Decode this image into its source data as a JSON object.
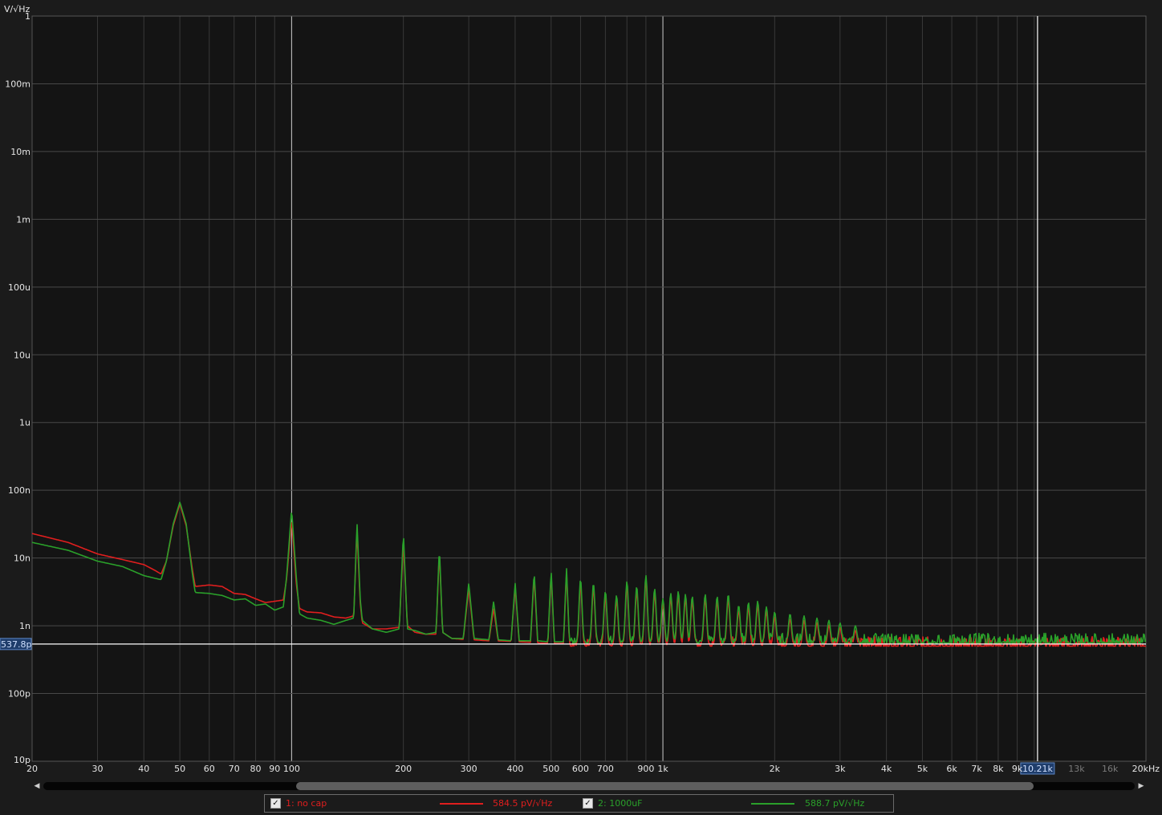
{
  "chart_data": {
    "type": "line",
    "ylabel": "V/√Hz",
    "xunit": "Hz",
    "xscale": "log",
    "yscale": "log",
    "xlim": [
      20,
      20000
    ],
    "ylim": [
      1e-11,
      1
    ],
    "grid": true,
    "y_ticks": [
      {
        "value": 1,
        "label": "1"
      },
      {
        "value": 0.1,
        "label": "100m"
      },
      {
        "value": 0.01,
        "label": "10m"
      },
      {
        "value": 0.001,
        "label": "1m"
      },
      {
        "value": 0.0001,
        "label": "100u"
      },
      {
        "value": 1e-05,
        "label": "10u"
      },
      {
        "value": 1e-06,
        "label": "1u"
      },
      {
        "value": 1e-07,
        "label": "100n"
      },
      {
        "value": 1e-08,
        "label": "10n"
      },
      {
        "value": 1e-09,
        "label": "1n"
      },
      {
        "value": 1e-10,
        "label": "100p"
      },
      {
        "value": 1e-11,
        "label": "10p"
      }
    ],
    "x_ticks": [
      {
        "value": 20,
        "label": "20"
      },
      {
        "value": 30,
        "label": "30"
      },
      {
        "value": 40,
        "label": "40"
      },
      {
        "value": 50,
        "label": "50"
      },
      {
        "value": 60,
        "label": "60"
      },
      {
        "value": 70,
        "label": "70"
      },
      {
        "value": 80,
        "label": "80"
      },
      {
        "value": 90,
        "label": "90"
      },
      {
        "value": 100,
        "label": "100"
      },
      {
        "value": 200,
        "label": "200"
      },
      {
        "value": 300,
        "label": "300"
      },
      {
        "value": 400,
        "label": "400"
      },
      {
        "value": 500,
        "label": "500"
      },
      {
        "value": 600,
        "label": "600"
      },
      {
        "value": 700,
        "label": "700"
      },
      {
        "value": 900,
        "label": "900"
      },
      {
        "value": 1000,
        "label": "1k"
      },
      {
        "value": 2000,
        "label": "2k"
      },
      {
        "value": 3000,
        "label": "3k"
      },
      {
        "value": 4000,
        "label": "4k"
      },
      {
        "value": 5000,
        "label": "5k"
      },
      {
        "value": 6000,
        "label": "6k"
      },
      {
        "value": 7000,
        "label": "7k"
      },
      {
        "value": 8000,
        "label": "8k"
      },
      {
        "value": 9000,
        "label": "9k"
      },
      {
        "value": 13000,
        "label": "13k",
        "dim": true
      },
      {
        "value": 16000,
        "label": "16k",
        "dim": true
      },
      {
        "value": 20000,
        "label": "20kHz"
      }
    ],
    "cursor_x": {
      "value": 10210,
      "label": "10.21k"
    },
    "cursor_y": {
      "value": 5.378e-10,
      "label": "537.8p"
    },
    "series": [
      {
        "name": "1: no cap",
        "color": "#e01e1e",
        "readout": "584.5 pV/√Hz",
        "noise_floor": 5e-10,
        "points": [
          [
            20,
            2.3e-08
          ],
          [
            25,
            1.7e-08
          ],
          [
            30,
            1.15e-08
          ],
          [
            35,
            9.5e-09
          ],
          [
            40,
            8e-09
          ],
          [
            43,
            6.5e-09
          ],
          [
            44.5,
            5.8e-09
          ],
          [
            46,
            9e-09
          ],
          [
            48,
            3e-08
          ],
          [
            50,
            6.3e-08
          ],
          [
            52,
            3e-08
          ],
          [
            54,
            7e-09
          ],
          [
            55,
            3.8e-09
          ],
          [
            60,
            4e-09
          ],
          [
            65,
            3.8e-09
          ],
          [
            70,
            3e-09
          ],
          [
            75,
            2.9e-09
          ],
          [
            80,
            2.5e-09
          ],
          [
            85,
            2.2e-09
          ],
          [
            90,
            2.3e-09
          ],
          [
            95,
            2.4e-09
          ],
          [
            97,
            5e-09
          ],
          [
            100,
            3.8e-08
          ],
          [
            103,
            4e-09
          ],
          [
            105,
            1.8e-09
          ],
          [
            110,
            1.6e-09
          ],
          [
            120,
            1.55e-09
          ],
          [
            130,
            1.35e-09
          ],
          [
            140,
            1.3e-09
          ],
          [
            147,
            1.4e-09
          ],
          [
            150,
            2.6e-08
          ],
          [
            153,
            2.2e-09
          ],
          [
            155,
            1.1e-09
          ],
          [
            165,
            9e-10
          ],
          [
            180,
            9e-10
          ],
          [
            195,
            9.5e-10
          ],
          [
            200,
            1.7e-08
          ],
          [
            205,
            1e-09
          ],
          [
            215,
            8e-10
          ],
          [
            230,
            7.5e-10
          ],
          [
            245,
            7.5e-10
          ],
          [
            250,
            1.3e-08
          ],
          [
            255,
            8e-10
          ],
          [
            270,
            6.5e-10
          ],
          [
            290,
            6.3e-10
          ],
          [
            300,
            3.6e-09
          ],
          [
            310,
            6.2e-10
          ],
          [
            340,
            6e-10
          ],
          [
            350,
            1.8e-09
          ],
          [
            360,
            6e-10
          ],
          [
            390,
            5.9e-10
          ],
          [
            400,
            3.8e-09
          ],
          [
            410,
            5.8e-10
          ],
          [
            440,
            5.7e-10
          ],
          [
            450,
            5.5e-09
          ],
          [
            460,
            5.6e-10
          ],
          [
            490,
            5.5e-10
          ],
          [
            500,
            6e-09
          ],
          [
            510,
            5.5e-10
          ],
          [
            540,
            5.5e-10
          ],
          [
            550,
            6.5e-09
          ],
          [
            560,
            5.5e-10
          ],
          [
            20000,
            5e-10
          ]
        ]
      },
      {
        "name": "2: 1000uF",
        "color": "#2aa02a",
        "readout": "588.7 pV/√Hz",
        "noise_floor": 5.6e-10,
        "points": [
          [
            20,
            1.7e-08
          ],
          [
            25,
            1.3e-08
          ],
          [
            30,
            9e-09
          ],
          [
            35,
            7.5e-09
          ],
          [
            40,
            5.5e-09
          ],
          [
            43,
            5e-09
          ],
          [
            44.5,
            4.8e-09
          ],
          [
            46,
            9e-09
          ],
          [
            48,
            3.2e-08
          ],
          [
            50,
            6.7e-08
          ],
          [
            52,
            3.2e-08
          ],
          [
            54,
            6e-09
          ],
          [
            55,
            3.1e-09
          ],
          [
            60,
            3e-09
          ],
          [
            65,
            2.8e-09
          ],
          [
            70,
            2.4e-09
          ],
          [
            75,
            2.5e-09
          ],
          [
            80,
            2e-09
          ],
          [
            85,
            2.1e-09
          ],
          [
            90,
            1.7e-09
          ],
          [
            95,
            1.9e-09
          ],
          [
            97,
            5.5e-09
          ],
          [
            100,
            5.3e-08
          ],
          [
            103,
            5e-09
          ],
          [
            105,
            1.5e-09
          ],
          [
            110,
            1.3e-09
          ],
          [
            120,
            1.2e-09
          ],
          [
            130,
            1.05e-09
          ],
          [
            140,
            1.2e-09
          ],
          [
            147,
            1.3e-09
          ],
          [
            150,
            3.4e-08
          ],
          [
            153,
            2.5e-09
          ],
          [
            155,
            1.2e-09
          ],
          [
            165,
            9e-10
          ],
          [
            180,
            8e-10
          ],
          [
            195,
            9e-10
          ],
          [
            200,
            2.4e-08
          ],
          [
            205,
            9e-10
          ],
          [
            215,
            8.5e-10
          ],
          [
            230,
            7.5e-10
          ],
          [
            245,
            8e-10
          ],
          [
            250,
            1.5e-08
          ],
          [
            255,
            8e-10
          ],
          [
            270,
            6.5e-10
          ],
          [
            290,
            6.5e-10
          ],
          [
            300,
            4.3e-09
          ],
          [
            310,
            6.5e-10
          ],
          [
            340,
            6.2e-10
          ],
          [
            350,
            2.3e-09
          ],
          [
            360,
            6.2e-10
          ],
          [
            390,
            6e-10
          ],
          [
            400,
            4.3e-09
          ],
          [
            410,
            6e-10
          ],
          [
            440,
            6e-10
          ],
          [
            450,
            6.5e-09
          ],
          [
            460,
            6e-10
          ],
          [
            490,
            5.8e-10
          ],
          [
            500,
            6.8e-09
          ],
          [
            510,
            5.8e-10
          ],
          [
            540,
            5.8e-10
          ],
          [
            550,
            7.3e-09
          ],
          [
            560,
            5.8e-10
          ],
          [
            20000,
            5.6e-10
          ]
        ],
        "harmonic_peaks": [
          [
            600,
            4.8e-09
          ],
          [
            650,
            4.2e-09
          ],
          [
            700,
            3.2e-09
          ],
          [
            750,
            2.8e-09
          ],
          [
            800,
            4.5e-09
          ],
          [
            850,
            3.8e-09
          ],
          [
            900,
            5.5e-09
          ],
          [
            950,
            3.5e-09
          ],
          [
            1000,
            2.5e-09
          ],
          [
            1050,
            3e-09
          ],
          [
            1100,
            3.2e-09
          ],
          [
            1150,
            2.9e-09
          ],
          [
            1200,
            2.7e-09
          ],
          [
            1300,
            2.9e-09
          ],
          [
            1400,
            2.7e-09
          ],
          [
            1500,
            2.9e-09
          ],
          [
            1600,
            2e-09
          ],
          [
            1700,
            2.2e-09
          ],
          [
            1800,
            2.3e-09
          ],
          [
            1900,
            1.9e-09
          ],
          [
            2000,
            1.6e-09
          ],
          [
            2200,
            1.5e-09
          ],
          [
            2400,
            1.4e-09
          ],
          [
            2600,
            1.3e-09
          ],
          [
            2800,
            1.2e-09
          ],
          [
            3000,
            1.1e-09
          ],
          [
            3300,
            1e-09
          ]
        ]
      }
    ]
  },
  "scrollbar": {
    "left_arrow": "◀",
    "right_arrow": "▶",
    "thumb_start_fraction": 0.2316,
    "thumb_end_fraction": 0.9072
  },
  "legend": {
    "check_mark": "✓",
    "entries": [
      {
        "label": "1: no cap",
        "value": "584.5 pV/√Hz",
        "color": "#e01e1e"
      },
      {
        "label": "2: 1000uF",
        "value": "588.7 pV/√Hz",
        "color": "#2aa02a"
      }
    ]
  }
}
